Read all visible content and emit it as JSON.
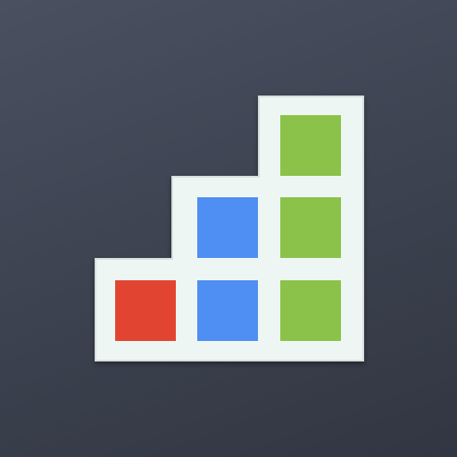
{
  "icon": {
    "name": "bar-chart-blocks-icon",
    "colors": {
      "background_top": "#4a5060",
      "background_bottom": "#323642",
      "frame_fill": "#eef6f4",
      "frame_stroke": "#d5e0dc",
      "red_block": "#e14531",
      "blue_block": "#4f8ef2",
      "green_block": "#8bc24a"
    },
    "columns": [
      {
        "name": "column-1",
        "blocks": 1,
        "color_key": "red_block"
      },
      {
        "name": "column-2",
        "blocks": 2,
        "color_key": "blue_block"
      },
      {
        "name": "column-3",
        "blocks": 3,
        "color_key": "green_block"
      }
    ]
  }
}
